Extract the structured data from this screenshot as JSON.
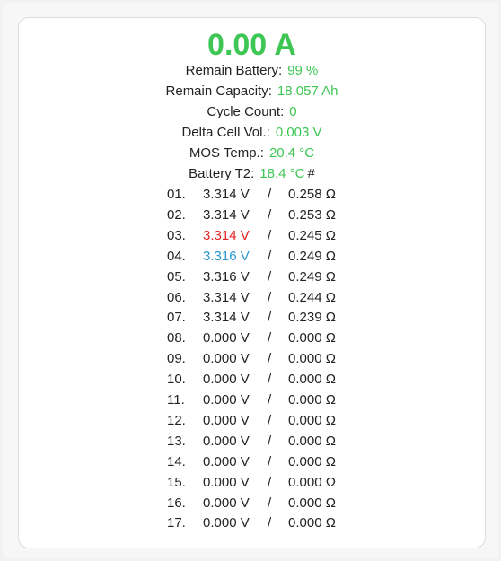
{
  "colors": {
    "green": "#3dc653",
    "red": "#e51f1f",
    "blue": "#2c96cf",
    "text": "#222222"
  },
  "current": "0.00 A",
  "stats": [
    {
      "name": "remain-battery",
      "label": "Remain Battery:",
      "value": "99 %"
    },
    {
      "name": "remain-capacity",
      "label": "Remain Capacity:",
      "value": "18.057 Ah"
    },
    {
      "name": "cycle-count",
      "label": "Cycle Count:",
      "value": "0"
    },
    {
      "name": "delta-cell-voltage",
      "label": "Delta Cell Vol.:",
      "value": "0.003 V"
    },
    {
      "name": "mos-temp",
      "label": "MOS Temp.:",
      "value": "20.4 °C"
    },
    {
      "name": "battery-t2",
      "label": "Battery T2:",
      "value": "18.4 °C",
      "suffix": "#"
    }
  ],
  "separator": "/",
  "cells": [
    {
      "index": "01.",
      "voltage": "3.314 V",
      "resistance": "0.258 Ω",
      "highlight": "none"
    },
    {
      "index": "02.",
      "voltage": "3.314 V",
      "resistance": "0.253 Ω",
      "highlight": "none"
    },
    {
      "index": "03.",
      "voltage": "3.314 V",
      "resistance": "0.245 Ω",
      "highlight": "min"
    },
    {
      "index": "04.",
      "voltage": "3.316 V",
      "resistance": "0.249 Ω",
      "highlight": "max"
    },
    {
      "index": "05.",
      "voltage": "3.316 V",
      "resistance": "0.249 Ω",
      "highlight": "none"
    },
    {
      "index": "06.",
      "voltage": "3.314 V",
      "resistance": "0.244 Ω",
      "highlight": "none"
    },
    {
      "index": "07.",
      "voltage": "3.314 V",
      "resistance": "0.239 Ω",
      "highlight": "none"
    },
    {
      "index": "08.",
      "voltage": "0.000 V",
      "resistance": "0.000 Ω",
      "highlight": "none"
    },
    {
      "index": "09.",
      "voltage": "0.000 V",
      "resistance": "0.000 Ω",
      "highlight": "none"
    },
    {
      "index": "10.",
      "voltage": "0.000 V",
      "resistance": "0.000 Ω",
      "highlight": "none"
    },
    {
      "index": "11.",
      "voltage": "0.000 V",
      "resistance": "0.000 Ω",
      "highlight": "none"
    },
    {
      "index": "12.",
      "voltage": "0.000 V",
      "resistance": "0.000 Ω",
      "highlight": "none"
    },
    {
      "index": "13.",
      "voltage": "0.000 V",
      "resistance": "0.000 Ω",
      "highlight": "none"
    },
    {
      "index": "14.",
      "voltage": "0.000 V",
      "resistance": "0.000 Ω",
      "highlight": "none"
    },
    {
      "index": "15.",
      "voltage": "0.000 V",
      "resistance": "0.000 Ω",
      "highlight": "none"
    },
    {
      "index": "16.",
      "voltage": "0.000 V",
      "resistance": "0.000 Ω",
      "highlight": "none"
    },
    {
      "index": "17.",
      "voltage": "0.000 V",
      "resistance": "0.000 Ω",
      "highlight": "none"
    }
  ]
}
